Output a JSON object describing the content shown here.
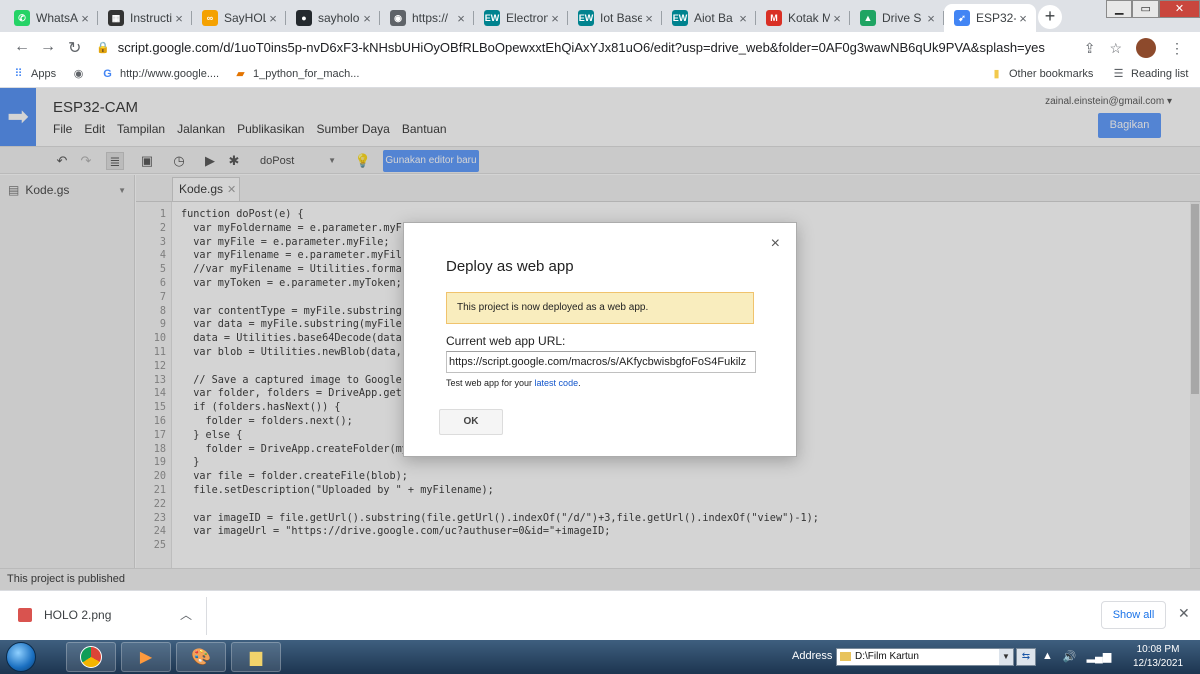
{
  "tabs": [
    {
      "title": "WhatsA",
      "icon": "whatsapp-icon",
      "color": "#25d366"
    },
    {
      "title": "Instructi",
      "icon": "instructables-icon",
      "color": "#333333"
    },
    {
      "title": "SayHOL",
      "icon": "codepen-icon",
      "color": "#f4a100"
    },
    {
      "title": "sayholo",
      "icon": "github-icon",
      "color": "#24292e"
    },
    {
      "title": "https://",
      "icon": "globe-icon",
      "color": "#5f6368"
    },
    {
      "title": "Electron",
      "icon": "ew-icon",
      "color": "#00838f"
    },
    {
      "title": "Iot Base",
      "icon": "ew-icon",
      "color": "#00838f"
    },
    {
      "title": "Aiot Ba",
      "icon": "ew-icon",
      "color": "#00838f"
    },
    {
      "title": "Kotak M",
      "icon": "gmail-icon",
      "color": "#d93025"
    },
    {
      "title": "Drive S",
      "icon": "drive-icon",
      "color": "#1fa463"
    },
    {
      "title": "ESP32-",
      "icon": "apps-script-icon",
      "color": "#4285f4"
    }
  ],
  "address": {
    "url": "script.google.com/d/1uoT0ins5p-nvD6xF3-kNHsbUHiOyOBfRLBoOpewxxtEhQiAxYJx81uO6/edit?usp=drive_web&folder=0AF0g3wawNB6qUk9PVA&splash=yes"
  },
  "bookmarks": {
    "apps": "Apps",
    "items": [
      "http://www.google....",
      "1_python_for_mach..."
    ],
    "other": "Other bookmarks",
    "reading": "Reading list"
  },
  "project": {
    "title": "ESP32-CAM",
    "account": "zainal.einstein@gmail.com ▾",
    "share": "Bagikan",
    "menu": [
      "File",
      "Edit",
      "Tampilan",
      "Jalankan",
      "Publikasikan",
      "Sumber Daya",
      "Bantuan"
    ]
  },
  "editor": {
    "function_select": "doPost",
    "new_editor": "Gunakan editor baru",
    "file_item": "Kode.gs",
    "file_tab": "Kode.gs",
    "status": "This project is published"
  },
  "code": [
    {
      "n": "1",
      "t": "function doPost(e) {"
    },
    {
      "n": "2",
      "t": "  var myFoldername = e.parameter.myF"
    },
    {
      "n": "3",
      "t": "  var myFile = e.parameter.myFile;"
    },
    {
      "n": "4",
      "t": "  var myFilename = e.parameter.myFil"
    },
    {
      "n": "5",
      "t": "  //var myFilename = Utilities.forma                                                       ename;"
    },
    {
      "n": "6",
      "t": "  var myToken = e.parameter.myToken;"
    },
    {
      "n": "7",
      "t": ""
    },
    {
      "n": "8",
      "t": "  var contentType = myFile.substring"
    },
    {
      "n": "9",
      "t": "  var data = myFile.substring(myFile"
    },
    {
      "n": "10",
      "t": "  data = Utilities.base64Decode(data"
    },
    {
      "n": "11",
      "t": "  var blob = Utilities.newBlob(data,"
    },
    {
      "n": "12",
      "t": ""
    },
    {
      "n": "13",
      "t": "  // Save a captured image to Google"
    },
    {
      "n": "14",
      "t": "  var folder, folders = DriveApp.get"
    },
    {
      "n": "15",
      "t": "  if (folders.hasNext()) {"
    },
    {
      "n": "16",
      "t": "    folder = folders.next();"
    },
    {
      "n": "17",
      "t": "  } else {"
    },
    {
      "n": "18",
      "t": "    folder = DriveApp.createFolder(myFoldername);"
    },
    {
      "n": "19",
      "t": "  }"
    },
    {
      "n": "20",
      "t": "  var file = folder.createFile(blob);"
    },
    {
      "n": "21",
      "t": "  file.setDescription(\"Uploaded by \" + myFilename);"
    },
    {
      "n": "22",
      "t": ""
    },
    {
      "n": "23",
      "t": "  var imageID = file.getUrl().substring(file.getUrl().indexOf(\"/d/\")+3,file.getUrl().indexOf(\"view\")-1);"
    },
    {
      "n": "24",
      "t": "  var imageUrl = \"https://drive.google.com/uc?authuser=0&id=\"+imageID;"
    },
    {
      "n": "25",
      "t": ""
    }
  ],
  "dialog": {
    "title": "Deploy as web app",
    "notice": "This project is now deployed as a web app.",
    "url_label": "Current web app URL:",
    "url_value": "https://script.google.com/macros/s/AKfycbwisbgfoFoS4Fukilz",
    "help_prefix": "Test web app for your ",
    "help_link": "latest code",
    "help_suffix": ".",
    "ok": "OK",
    "close": "×"
  },
  "download": {
    "file": "HOLO 2.png",
    "show_all": "Show all"
  },
  "taskbar": {
    "address_label": "Address",
    "address_value": "D:\\Film Kartun",
    "time": "10:08 PM",
    "date": "12/13/2021"
  }
}
